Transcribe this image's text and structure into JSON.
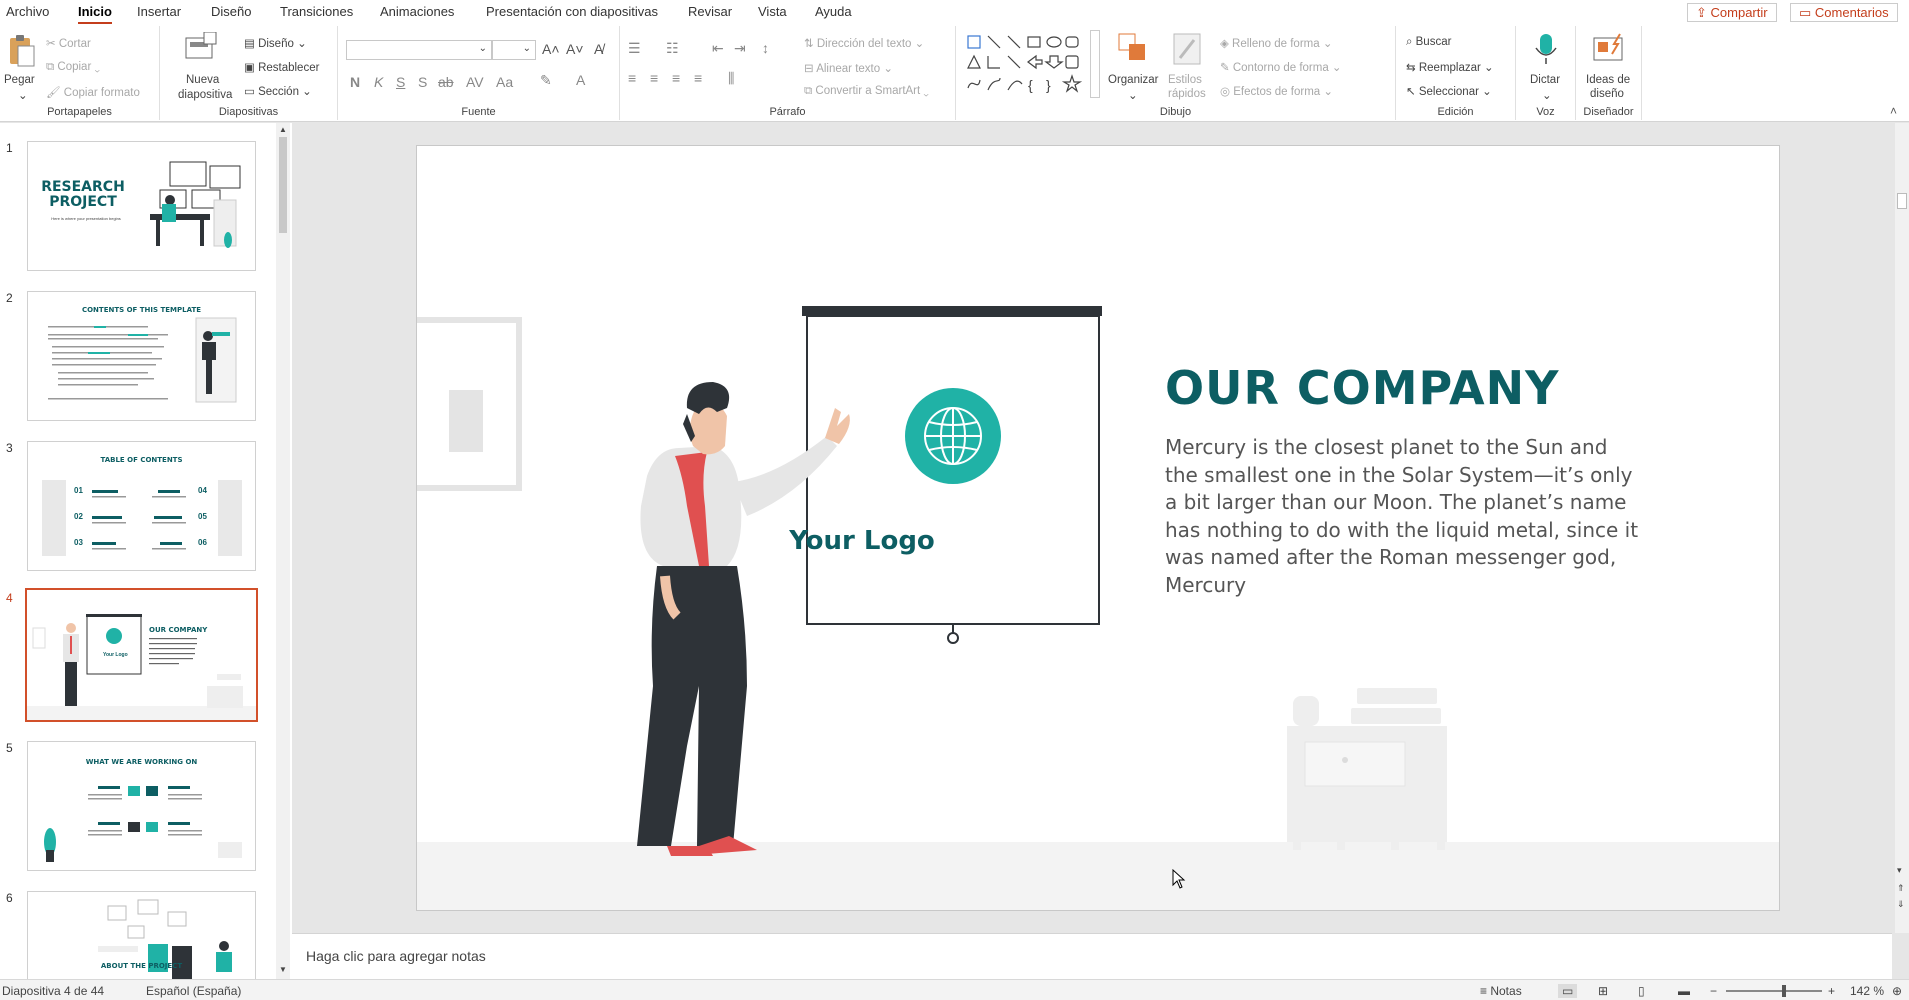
{
  "menu": {
    "items": [
      "Archivo",
      "Inicio",
      "Insertar",
      "Diseño",
      "Transiciones",
      "Animaciones",
      "Presentación con diapositivas",
      "Revisar",
      "Vista",
      "Ayuda"
    ],
    "share": "Compartir",
    "comments": "Comentarios"
  },
  "ribbon": {
    "clipboard": {
      "label": "Portapapeles",
      "paste": "Pegar",
      "cut": "Cortar",
      "copy": "Copiar",
      "format": "Copiar formato"
    },
    "slides": {
      "label": "Diapositivas",
      "new1": "Nueva",
      "new2": "diapositiva",
      "layout": "Diseño",
      "reset": "Restablecer",
      "section": "Sección"
    },
    "font": {
      "label": "Fuente"
    },
    "paragraph": {
      "label": "Párrafo",
      "direction": "Dirección del texto",
      "align": "Alinear texto",
      "smartart": "Convertir a SmartArt"
    },
    "drawing": {
      "label": "Dibujo",
      "arrange": "Organizar",
      "styles1": "Estilos",
      "styles2": "rápidos",
      "fill": "Relleno de forma",
      "outline": "Contorno de forma",
      "effects": "Efectos de forma"
    },
    "editing": {
      "label": "Edición",
      "find": "Buscar",
      "replace": "Reemplazar",
      "select": "Seleccionar"
    },
    "voice": {
      "label": "Voz",
      "dictate": "Dictar"
    },
    "designer": {
      "label": "Diseñador",
      "ideas1": "Ideas de",
      "ideas2": "diseño"
    }
  },
  "thumbnails": [
    {
      "num": "1",
      "title": "RESEARCH PROJECT",
      "sub": "Here is where your presentation begins"
    },
    {
      "num": "2",
      "title": "CONTENTS OF THIS TEMPLATE"
    },
    {
      "num": "3",
      "title": "TABLE OF CONTENTS",
      "items": [
        "01",
        "02",
        "03",
        "04",
        "05",
        "06"
      ]
    },
    {
      "num": "4",
      "title": "OUR COMPANY",
      "logo": "Your Logo"
    },
    {
      "num": "5",
      "title": "WHAT WE ARE WORKING ON"
    },
    {
      "num": "6",
      "title": "ABOUT THE PROJECT"
    }
  ],
  "slide": {
    "title": "OUR COMPANY",
    "body": "Mercury is the closest planet to the Sun and the smallest one in the Solar System—it’s only a bit larger than our Moon. The planet’s name has nothing to do with the liquid metal, since it was named after the Roman messenger god, Mercury",
    "logo": "Your Logo"
  },
  "notes": {
    "placeholder": "Haga clic para agregar notas"
  },
  "status": {
    "slide": "Diapositiva 4 de 44",
    "language": "Español (España)",
    "notes": "Notas",
    "zoom": "142 %"
  },
  "colors": {
    "accent": "#c43e1c",
    "teal": "#20b2a6",
    "dark_teal": "#0d5e63"
  }
}
